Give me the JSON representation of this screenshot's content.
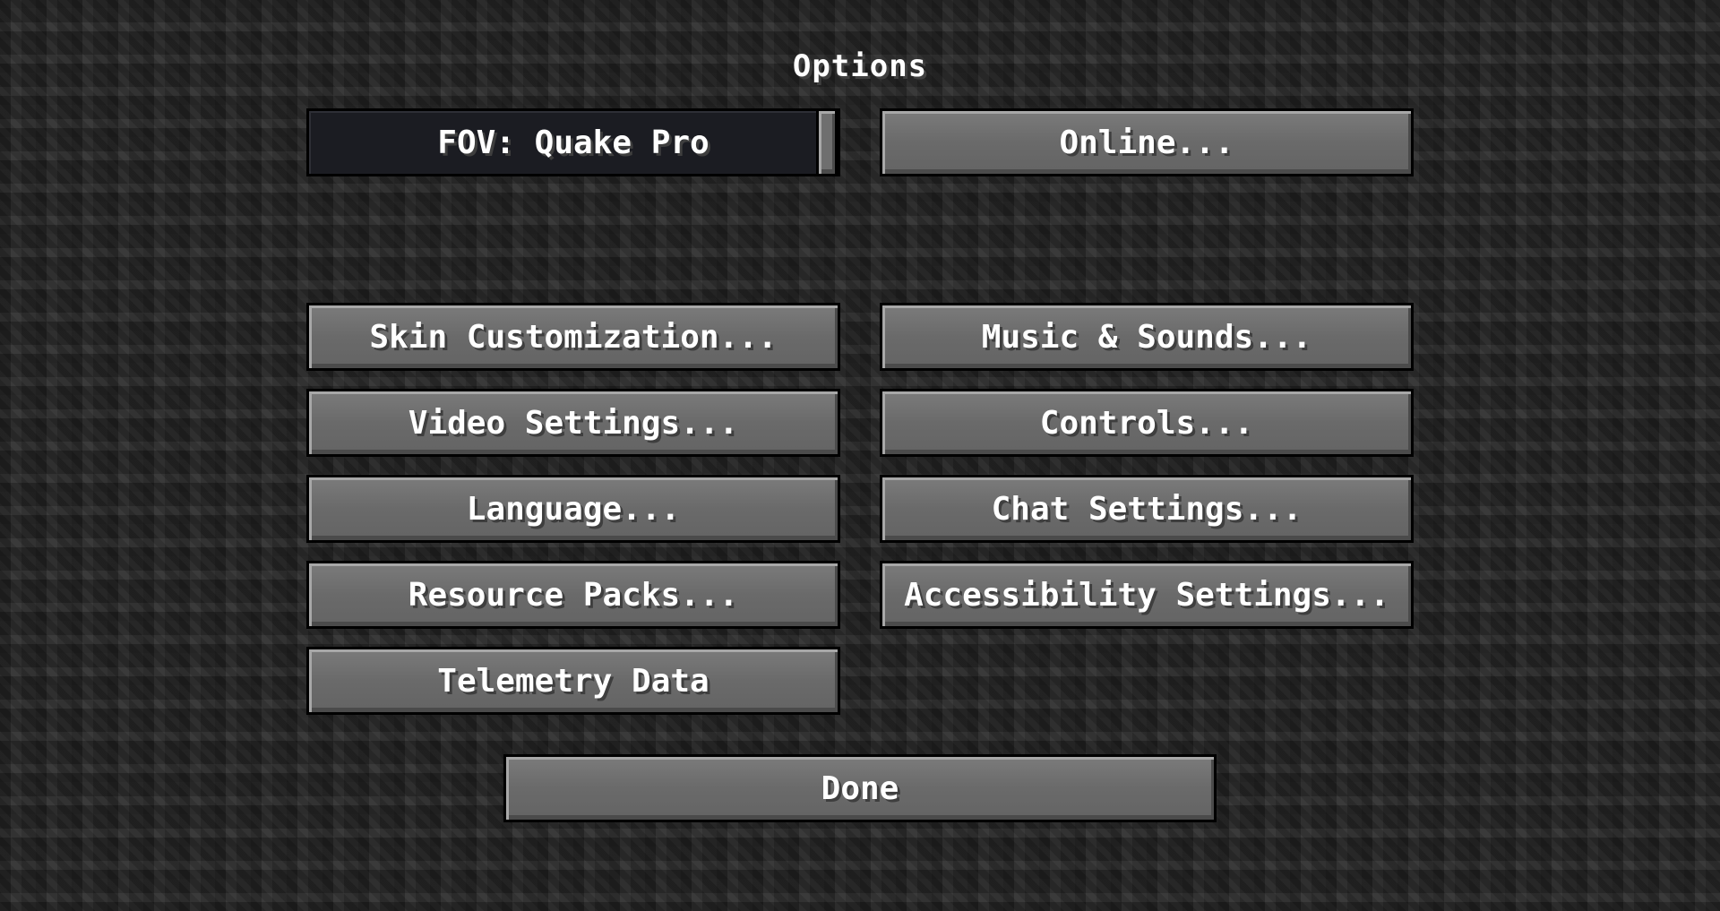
{
  "title": "Options",
  "fov": {
    "label": "FOV: Quake Pro",
    "slider_value_fraction": 1.0
  },
  "online_label": "Online...",
  "buttons": {
    "skin": "Skin Customization...",
    "music": "Music & Sounds...",
    "video": "Video Settings...",
    "controls": "Controls...",
    "language": "Language...",
    "chat": "Chat Settings...",
    "resource": "Resource Packs...",
    "accessibility": "Accessibility Settings...",
    "telemetry": "Telemetry Data"
  },
  "done_label": "Done"
}
